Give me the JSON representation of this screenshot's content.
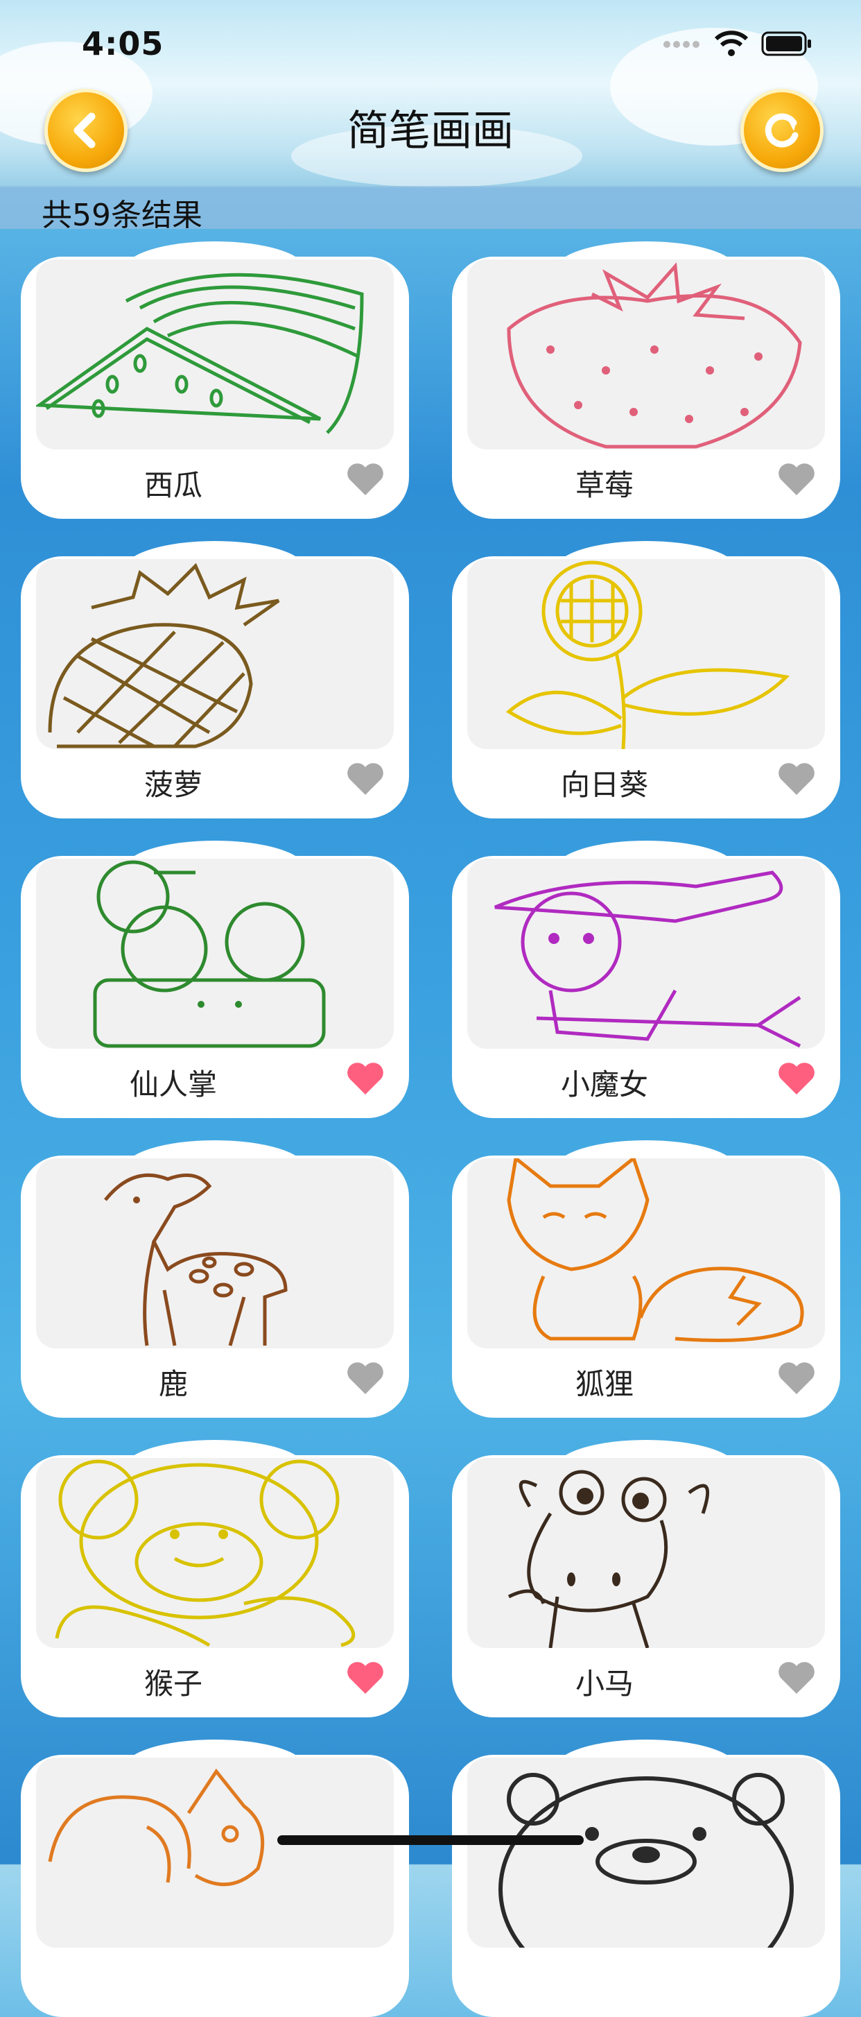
{
  "status": {
    "time": "4:05"
  },
  "header": {
    "title": "简笔画画"
  },
  "results": {
    "count_text": "共59条结果"
  },
  "colors": {
    "heart_active": "#ff5f7e",
    "heart_inactive": "#a9a9a9",
    "button_accent": "#f7a90a"
  },
  "items": [
    {
      "label": "西瓜",
      "favorited": false,
      "icon": "watermelon-drawing",
      "color": "#2e9a3a"
    },
    {
      "label": "草莓",
      "favorited": false,
      "icon": "strawberry-drawing",
      "color": "#e0607a"
    },
    {
      "label": "菠萝",
      "favorited": false,
      "icon": "pineapple-drawing",
      "color": "#7a5a1e"
    },
    {
      "label": "向日葵",
      "favorited": false,
      "icon": "sunflower-drawing",
      "color": "#e6c400"
    },
    {
      "label": "仙人掌",
      "favorited": true,
      "icon": "cactus-drawing",
      "color": "#2e8a2e"
    },
    {
      "label": "小魔女",
      "favorited": true,
      "icon": "little-witch-drawing",
      "color": "#b02ac0"
    },
    {
      "label": "鹿",
      "favorited": false,
      "icon": "deer-drawing",
      "color": "#8a4a1e"
    },
    {
      "label": "狐狸",
      "favorited": false,
      "icon": "fox-drawing",
      "color": "#e67a10"
    },
    {
      "label": "猴子",
      "favorited": true,
      "icon": "monkey-drawing",
      "color": "#d8c200"
    },
    {
      "label": "小马",
      "favorited": false,
      "icon": "pony-drawing",
      "color": "#3a2a1e"
    },
    {
      "label": "",
      "favorited": false,
      "icon": "squirrel-drawing",
      "color": "#e07a20"
    },
    {
      "label": "",
      "favorited": false,
      "icon": "bear-drawing",
      "color": "#2a2a2a"
    }
  ]
}
